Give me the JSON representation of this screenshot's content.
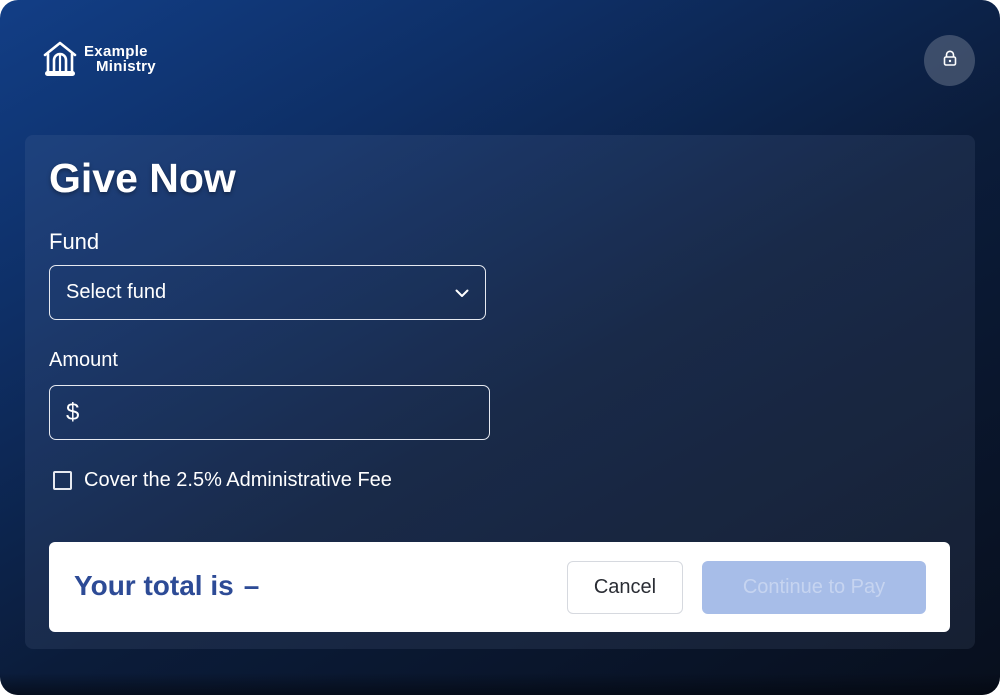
{
  "brand": {
    "name_line1": "Example",
    "name_line2": "Ministry",
    "logo_icon": "church-building-icon"
  },
  "header": {
    "lock_icon": "lock-icon"
  },
  "form": {
    "title": "Give Now",
    "fund": {
      "label": "Fund",
      "selected": "Select fund",
      "icon": "chevron-down-icon"
    },
    "amount": {
      "label": "Amount",
      "currency_symbol": "$",
      "value": ""
    },
    "fee": {
      "label": "Cover the 2.5% Administrative Fee",
      "checked": false
    }
  },
  "footer": {
    "total_label": "Your total is",
    "total_value": "–",
    "cancel_label": "Cancel",
    "continue_label": "Continue to Pay"
  },
  "colors": {
    "background_top": "#123e86",
    "background_bottom": "#080f1d",
    "total_text": "#2d4b96",
    "continue_bg_disabled": "#a7bde8",
    "continue_text_disabled": "#c6d4f0"
  }
}
